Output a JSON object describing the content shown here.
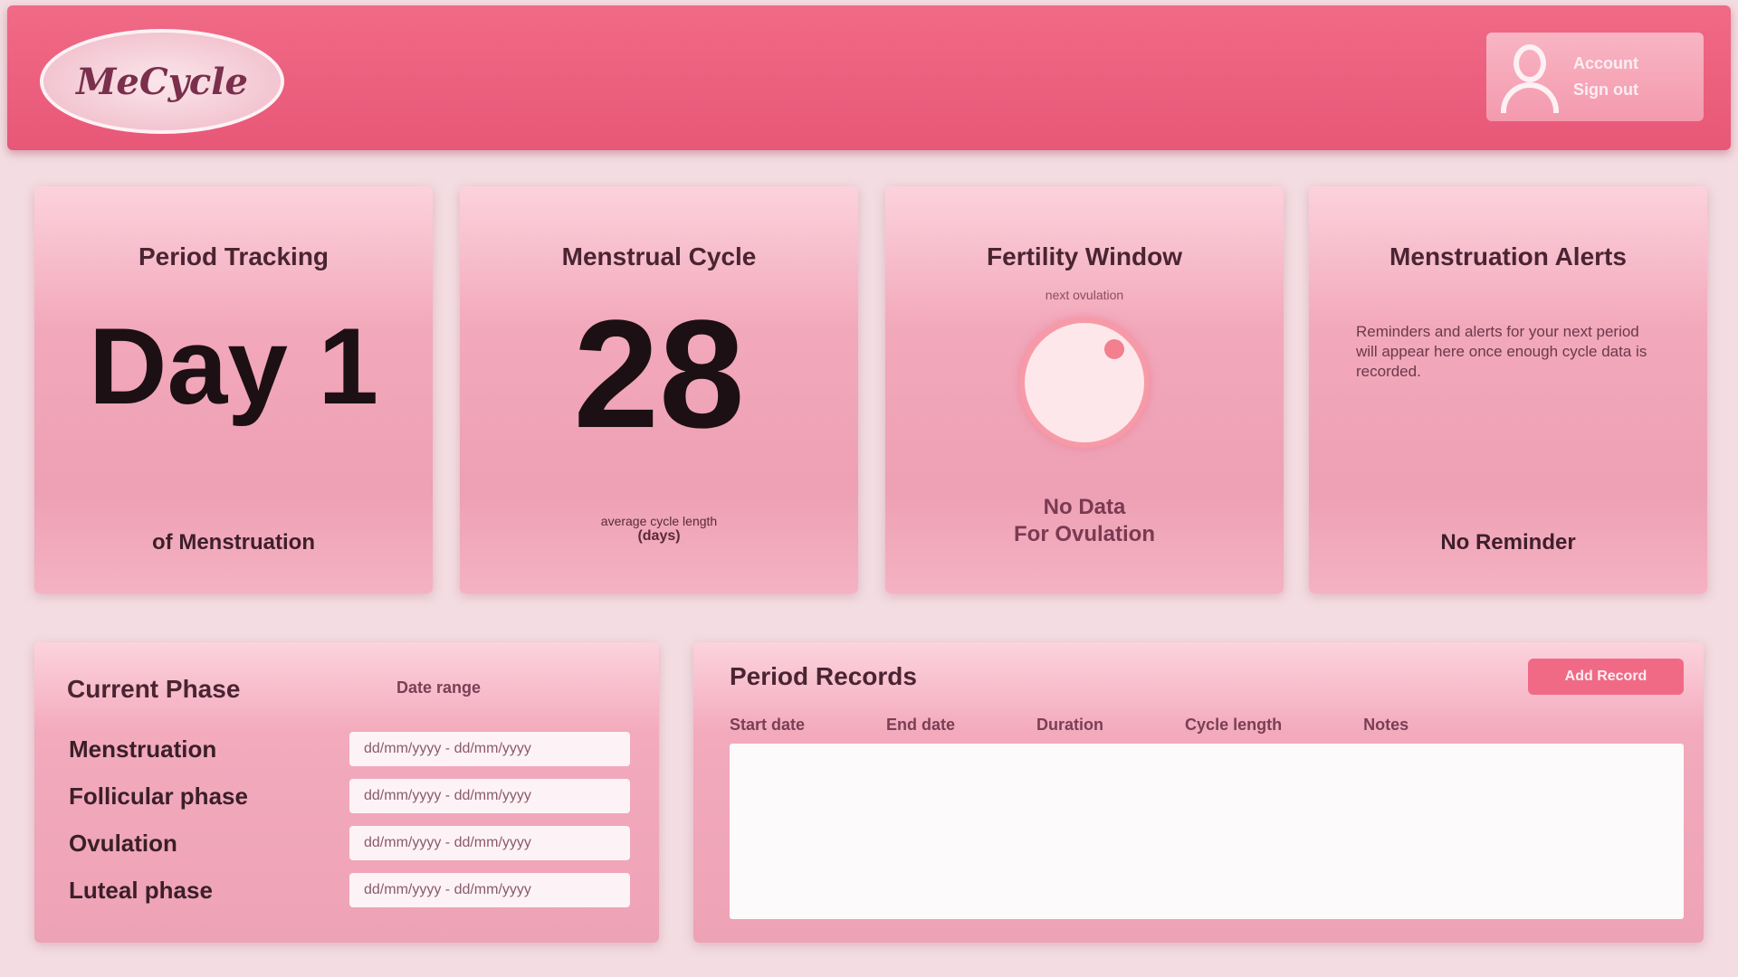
{
  "header": {
    "logo_text": "MeCycle",
    "user": {
      "name": "Account",
      "action": "Sign out"
    }
  },
  "cards": {
    "period": {
      "title": "Period Tracking",
      "value": "Day 1",
      "footer": "of Menstruation"
    },
    "cycle": {
      "title": "Menstrual Cycle",
      "value": "28",
      "note_line1": "average cycle length",
      "note_line2": "(days)"
    },
    "fertility": {
      "title": "Fertility Window",
      "subtitle": "next ovulation",
      "status_line1": "No Data",
      "status_line2": "For Ovulation"
    },
    "alert": {
      "title": "Menstruation Alerts",
      "body": "Reminders and alerts for your next period will appear here once enough cycle data is recorded.",
      "footer": "No Reminder"
    }
  },
  "current_phase": {
    "title": "Current Phase",
    "range_header": "Date range",
    "phases": [
      {
        "name": "Menstruation",
        "range": "dd/mm/yyyy - dd/mm/yyyy"
      },
      {
        "name": "Follicular phase",
        "range": "dd/mm/yyyy - dd/mm/yyyy"
      },
      {
        "name": "Ovulation",
        "range": "dd/mm/yyyy - dd/mm/yyyy"
      },
      {
        "name": "Luteal phase",
        "range": "dd/mm/yyyy - dd/mm/yyyy"
      }
    ]
  },
  "period_records": {
    "title": "Period Records",
    "add_button": "Add Record",
    "columns": [
      "Start date",
      "End date",
      "Duration",
      "Cycle length",
      "Notes"
    ]
  },
  "colors": {
    "header": "#e85777",
    "card": "#f2a8bb",
    "background": "#f3dde2",
    "accent": "#f06a86"
  }
}
